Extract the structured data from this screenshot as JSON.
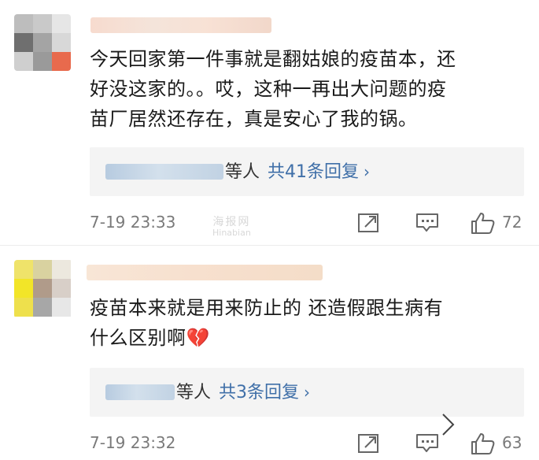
{
  "comments": [
    {
      "text_lines": [
        "今天回家第一件事就是翻姑娘的疫苗本，还",
        "好没这家的。。哎，这种一再出大问题的疫",
        "苗厂居然还存在，真是安心了我的锅。"
      ],
      "reply_people": "等人",
      "reply_count": "共41条回复",
      "reply_chevron": "›",
      "timestamp": "7-19 23:33",
      "likes": "72"
    },
    {
      "text_lines": [
        "疫苗本来就是用来防止的 还造假跟生病有",
        "什么区别啊💔"
      ],
      "reply_people": "等人",
      "reply_count": "共3条回复",
      "reply_chevron": "›",
      "timestamp": "7-19 23:32",
      "likes": "63"
    }
  ],
  "watermark": {
    "line1": "海报网",
    "line2": "Hinabian"
  },
  "icons": {
    "forward": "share-forward-icon",
    "comment": "comment-icon",
    "like": "thumbs-up-icon"
  },
  "colors": {
    "link": "#3f6fa8",
    "meta": "#7a7a7a",
    "reply_bg": "#f4f4f4"
  }
}
